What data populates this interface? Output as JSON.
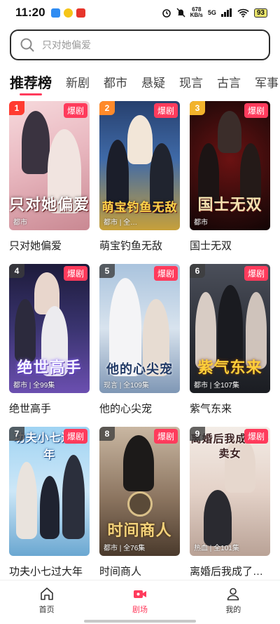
{
  "status": {
    "time": "11:20",
    "net_speed_value": "678",
    "net_speed_unit": "KB/s",
    "signal_label": "5G",
    "battery": "93"
  },
  "search": {
    "placeholder": "只对她偏爱"
  },
  "tabs": [
    {
      "label": "推荐榜"
    },
    {
      "label": "新剧"
    },
    {
      "label": "都市"
    },
    {
      "label": "悬疑"
    },
    {
      "label": "现言"
    },
    {
      "label": "古言"
    },
    {
      "label": "军事"
    }
  ],
  "hot_label": "爆剧",
  "dramas": [
    {
      "rank": "1",
      "name": "只对她偏爱",
      "meta": "都市",
      "poster_title": "只对她偏爱"
    },
    {
      "rank": "2",
      "name": "萌宝钓鱼无敌",
      "meta": "都市 | 全…",
      "poster_title": "萌宝钓鱼无敌"
    },
    {
      "rank": "3",
      "name": "国士无双",
      "meta": "都市",
      "poster_title": "国士无双"
    },
    {
      "rank": "4",
      "name": "绝世高手",
      "meta": "都市 | 全99集",
      "poster_title": "绝世高手"
    },
    {
      "rank": "5",
      "name": "他的心尖宠",
      "meta": "现言 | 全109集",
      "poster_title": "他的心尖宠"
    },
    {
      "rank": "6",
      "name": "紫气东来",
      "meta": "都市 | 全107集",
      "poster_title": "紫气东来"
    },
    {
      "rank": "7",
      "name": "功夫小七过大年",
      "meta": "",
      "poster_title": "功夫小七过大年"
    },
    {
      "rank": "8",
      "name": "时间商人",
      "meta": "都市 | 全76集",
      "poster_title": "时间商人"
    },
    {
      "rank": "9",
      "name": "离婚后我成了…",
      "meta": "热血 | 全101集",
      "poster_title": "离婚后我成了外卖女"
    }
  ],
  "bottom_nav": [
    {
      "label": "首页"
    },
    {
      "label": "剧场"
    },
    {
      "label": "我的"
    }
  ],
  "colors": {
    "accent": "#ff3b5c",
    "rank1": "#ff3b30",
    "rank2": "#ff8a2a",
    "rank3": "#f2b32c"
  }
}
